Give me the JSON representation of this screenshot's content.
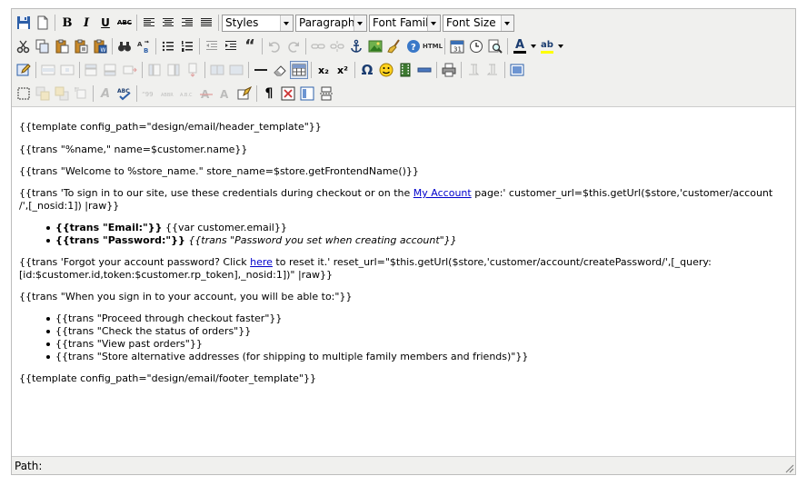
{
  "toolbar": {
    "styles_value": "Styles",
    "format_value": "Paragraph",
    "font_family_value": "Font Family",
    "font_size_value": "Font Size"
  },
  "content": {
    "line1": "{{template config_path=\"design/email/header_template\"}}",
    "line2": "{{trans \"%name,\" name=$customer.name}}",
    "line3": "{{trans \"Welcome to %store_name.\" store_name=$store.getFrontendName()}}",
    "line4_before": "{{trans 'To sign in to our site, use these credentials during checkout or on the ",
    "line4_link": "My Account",
    "line4_after_a": " page:' customer_url=$this.getUrl($store,'customer/account",
    "line4_after_b": "/',[_nosid:1]) |raw}}",
    "email_label": "{{trans \"Email:\"}}",
    "email_value": " {{var customer.email}}",
    "password_label": "{{trans \"Password:\"}}",
    "password_value": "{{trans \"Password you set when creating account\"}}",
    "line6_before": "{{trans 'Forgot your account password? Click ",
    "line6_link": "here",
    "line6_after_a": " to reset it.' reset_url=\"$this.getUrl($store,'customer/account/createPassword/',[_query:",
    "line6_after_b": "[id:$customer.id,token:$customer.rp_token],_nosid:1])\" |raw}}",
    "line7": "{{trans \"When you sign in to your account, you will be able to:\"}}",
    "benefits": [
      "{{trans \"Proceed through checkout faster\"}}",
      "{{trans \"Check the status of orders\"}}",
      "{{trans \"View past orders\"}}",
      "{{trans \"Store alternative addresses (for shipping to multiple family members and friends)\"}}"
    ],
    "footer_line": "{{template config_path=\"design/email/footer_template\"}}"
  },
  "statusbar": {
    "path_label": "Path:"
  },
  "icons": {
    "bold": "B",
    "italic": "I",
    "underline": "U",
    "strike": "ABC",
    "html": "HTML",
    "omega": "Ω",
    "pilcrow": "¶",
    "subscript": "x₂",
    "superscript": "x²",
    "font_color": "A",
    "highlight": "ab",
    "quote_marks": "“",
    "styleprops": "A"
  },
  "colors": {
    "toolbar_bg": "#f0f0ee",
    "link": "#0000cc",
    "font_color_bar": "#000000",
    "highlight_bar": "#ffff00"
  }
}
